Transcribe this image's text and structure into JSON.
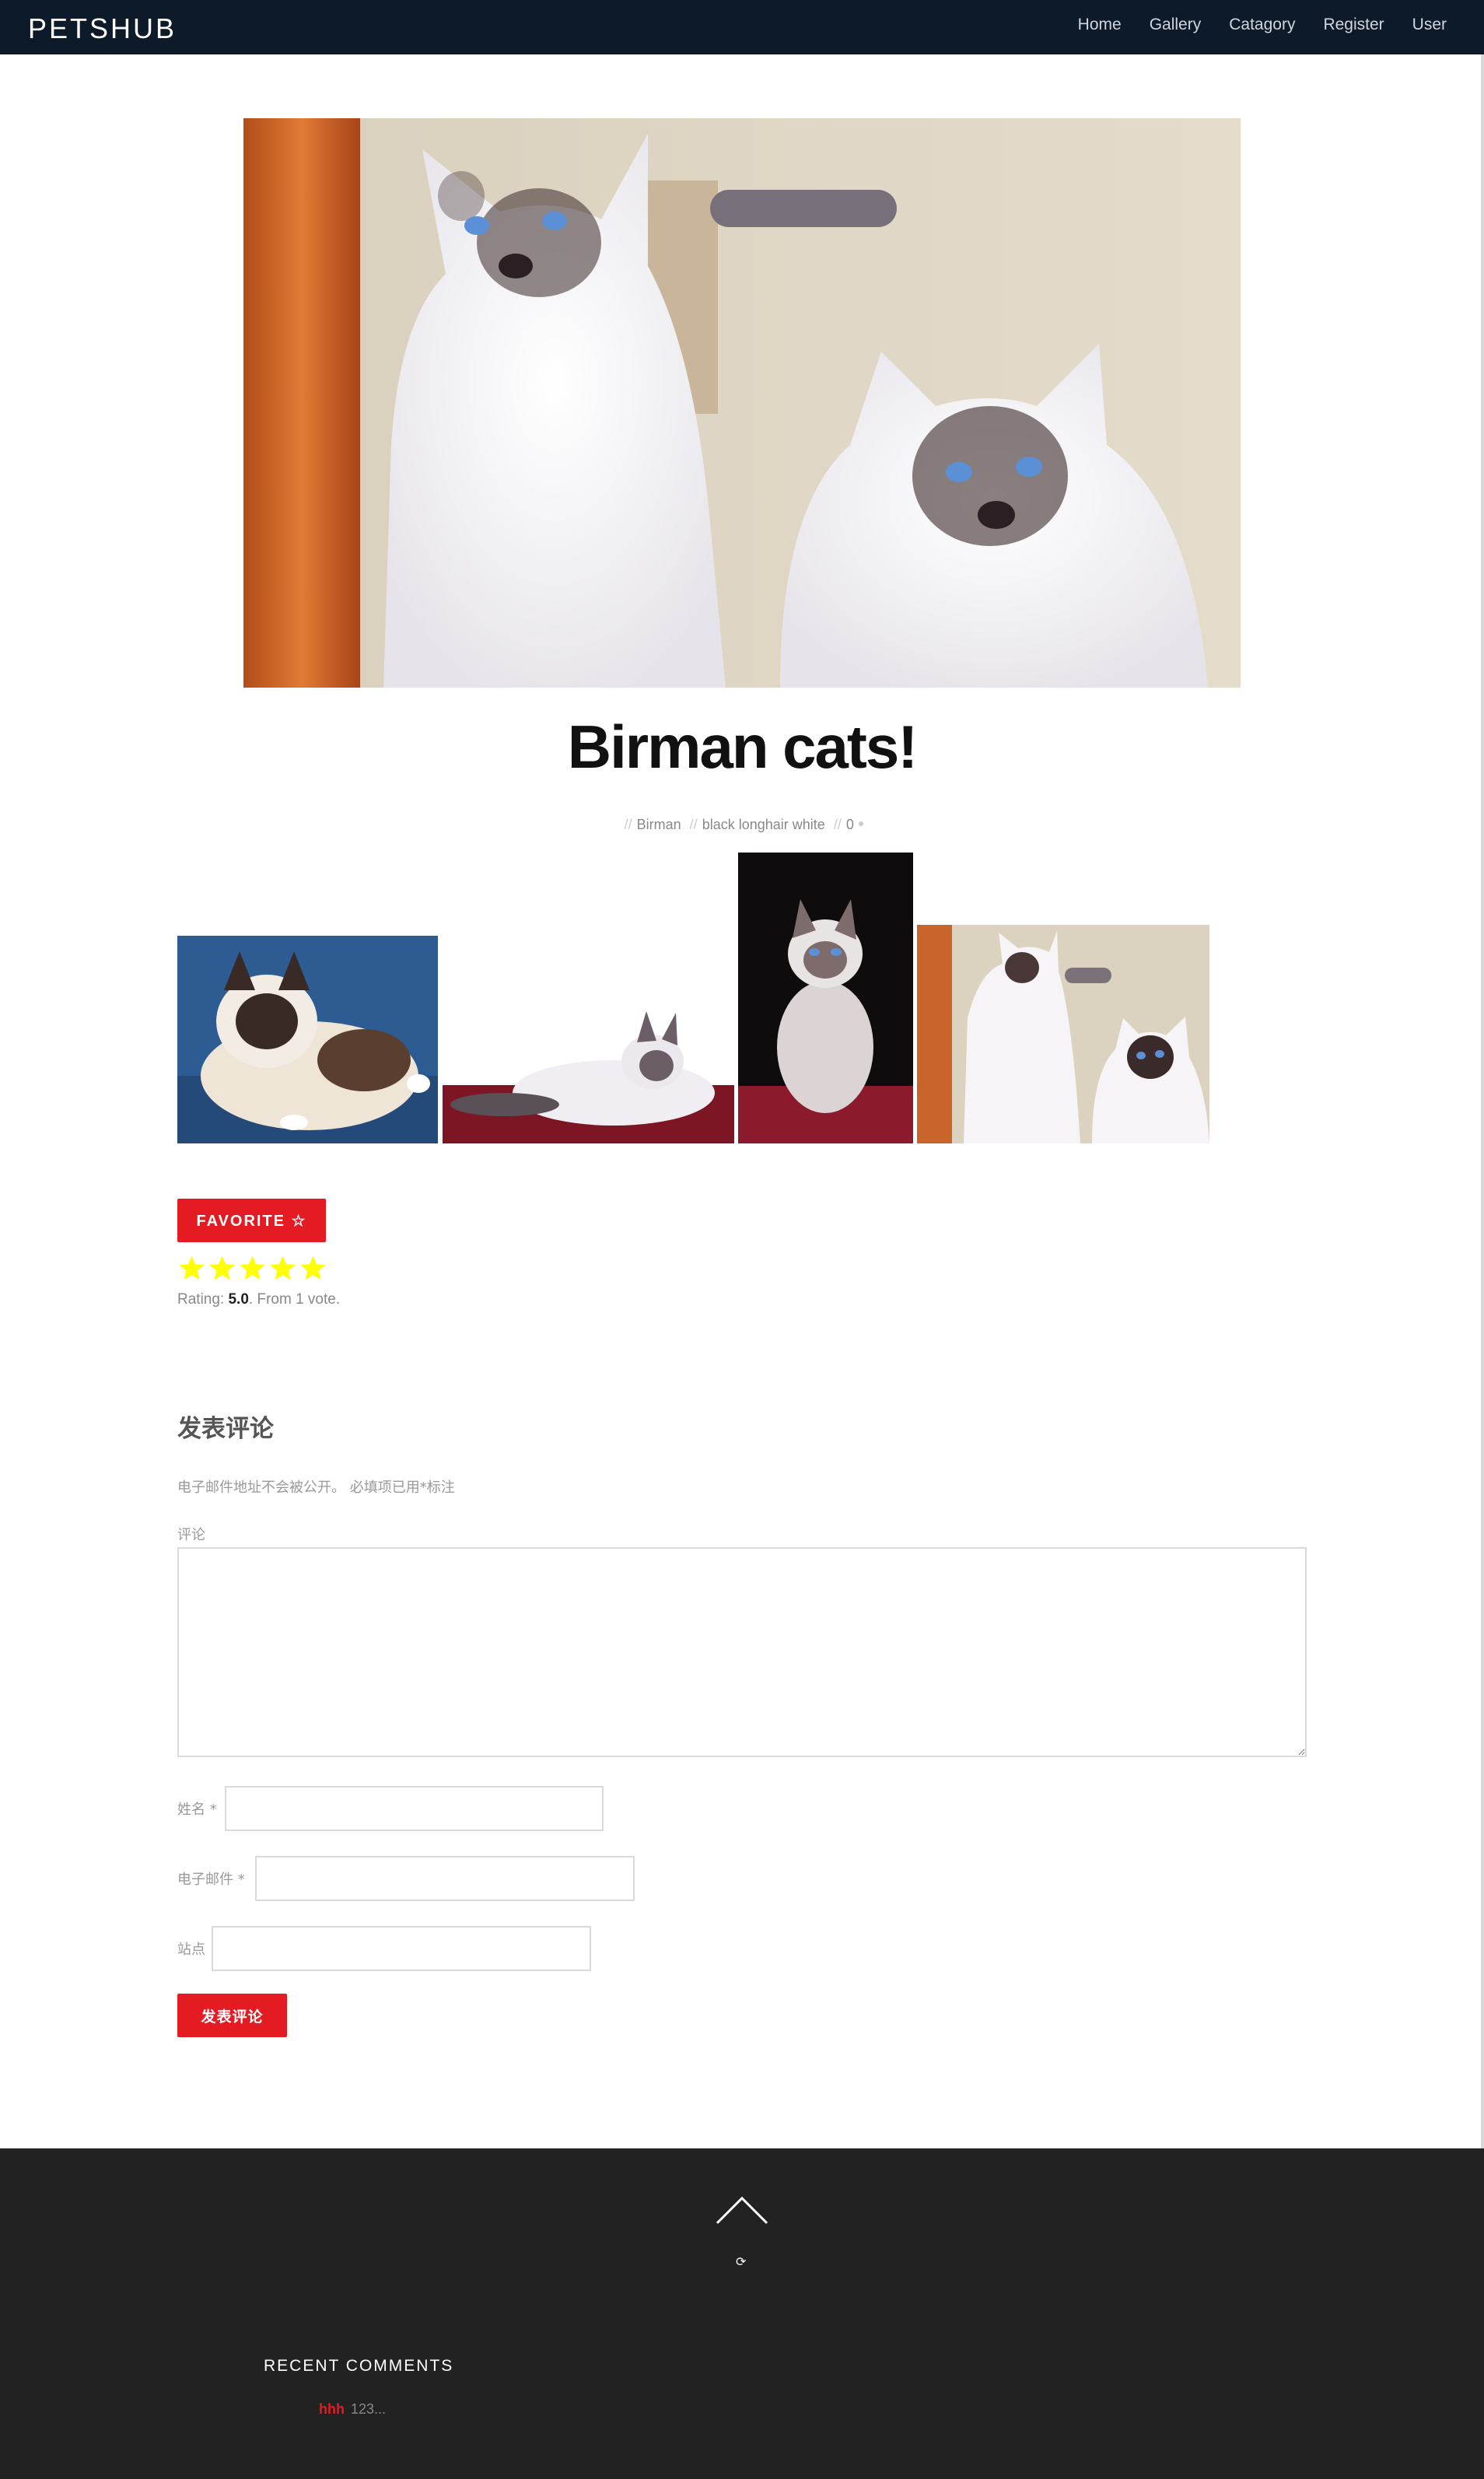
{
  "header": {
    "brand": "PETSHUB",
    "nav": [
      "Home",
      "Gallery",
      "Catagory",
      "Register",
      "User"
    ]
  },
  "post": {
    "title": "Birman cats!",
    "category": "Birman",
    "tags": [
      "black",
      "longhair",
      "white"
    ],
    "comment_count": "0",
    "meta_separator": "//"
  },
  "actions": {
    "favorite_label": "FAVORITE ☆"
  },
  "rating": {
    "label": "Rating: ",
    "value": "5.0",
    "suffix": ". From 1 vote.",
    "stars_filled": 5,
    "stars_total": 5,
    "star_color": "#ffff00"
  },
  "comment_form": {
    "title": "发表评论",
    "notes": "电子邮件地址不会被公开。 必填项已用*标注",
    "comment_label": "评论",
    "name_label": "姓名 *",
    "email_label": "电子邮件 *",
    "site_label": "站点",
    "submit_label": "发表评论"
  },
  "footer": {
    "recent_comments_title": "RECENT COMMENTS",
    "recent_comments": [
      {
        "author": "hhh",
        "excerpt": "123..."
      }
    ]
  },
  "colors": {
    "accent": "#e41b23",
    "header_bg": "#0c1a2a",
    "footer_bg": "#222222"
  },
  "icons": [
    "scroll-up-arrow-icon",
    "comment-bubble-icon",
    "star-icon"
  ]
}
